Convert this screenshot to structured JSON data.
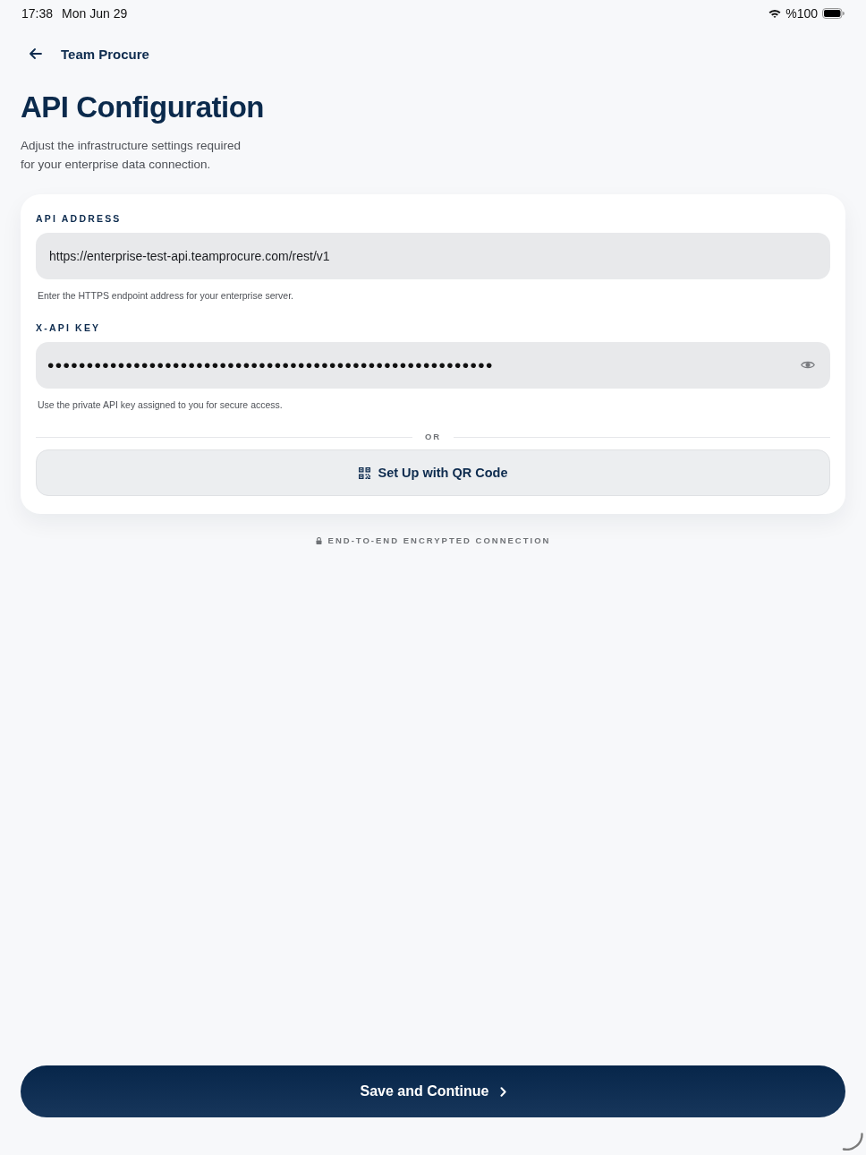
{
  "status_bar": {
    "time": "17:38",
    "date": "Mon Jun 29",
    "battery_text": "%100"
  },
  "nav": {
    "title": "Team Procure"
  },
  "header": {
    "title": "API Configuration",
    "subtitle": "Adjust the infrastructure settings required for your enterprise data connection."
  },
  "fields": [
    {
      "kind": "text",
      "label": "API ADDRESS",
      "value": "https://enterprise-test-api.teamprocure.com/rest/v1",
      "help": "Enter the HTTPS endpoint address for your enterprise server."
    },
    {
      "kind": "secret",
      "label": "X-API KEY",
      "value": "•••••••••••••••••••••••••••••••••••••••••••••••••••••••••",
      "help": "Use the private API key assigned to you for secure access."
    }
  ],
  "divider_text": "OR",
  "qr_button": {
    "label": "Set Up with QR Code"
  },
  "security_note": "END-TO-END ENCRYPTED CONNECTION",
  "primary_button": {
    "label": "Save and Continue"
  }
}
